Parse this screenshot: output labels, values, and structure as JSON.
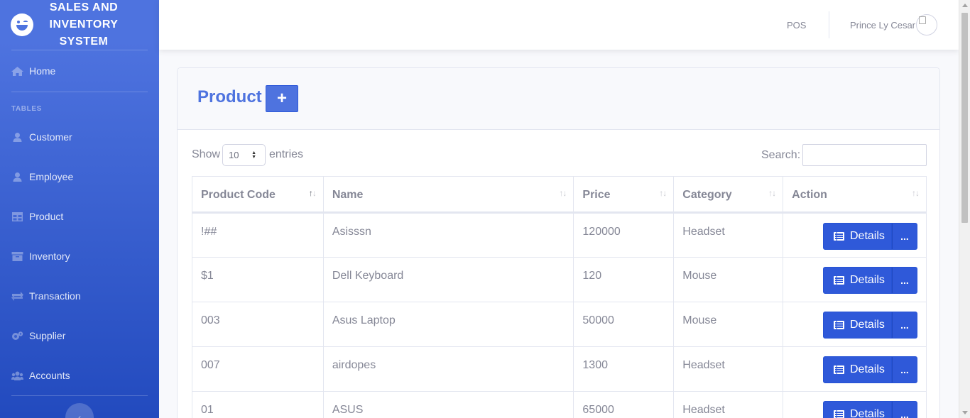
{
  "brand": {
    "title": "SALES AND INVENTORY SYSTEM",
    "logo_icon": "laugh-wink-icon"
  },
  "sidebar": {
    "home": {
      "label": "Home",
      "icon": "home-icon"
    },
    "heading": "TABLES",
    "items": [
      {
        "label": "Customer",
        "icon": "user-icon"
      },
      {
        "label": "Employee",
        "icon": "user-icon"
      },
      {
        "label": "Product",
        "icon": "table-icon"
      },
      {
        "label": "Inventory",
        "icon": "archive-icon"
      },
      {
        "label": "Transaction",
        "icon": "exchange-icon"
      },
      {
        "label": "Supplier",
        "icon": "cogs-icon"
      },
      {
        "label": "Accounts",
        "icon": "users-icon"
      }
    ],
    "toggle_icon": "chevron-left-icon"
  },
  "topbar": {
    "pos_label": "POS",
    "user_name": "Prince Ly Cesar"
  },
  "page": {
    "title": "Product",
    "add_icon": "+",
    "show_label": "Show",
    "page_length": "10",
    "entries_label": "entries",
    "search_label": "Search:",
    "search_value": ""
  },
  "table": {
    "columns": [
      "Product Code",
      "Name",
      "Price",
      "Category",
      "Action"
    ],
    "details_label": "Details",
    "more_label": "...",
    "rows": [
      {
        "code": "!##",
        "name": "Asisssn",
        "price": "120000",
        "category": "Headset"
      },
      {
        "code": "$1",
        "name": "Dell Keyboard",
        "price": "120",
        "category": "Mouse"
      },
      {
        "code": "003",
        "name": "Asus Laptop",
        "price": "50000",
        "category": "Mouse"
      },
      {
        "code": "007",
        "name": "airdopes",
        "price": "1300",
        "category": "Headset"
      },
      {
        "code": "01",
        "name": "ASUS",
        "price": "65000",
        "category": "Headset"
      }
    ]
  },
  "colors": {
    "primary": "#4e73df",
    "primary_dark": "#224abe",
    "text": "#858796"
  }
}
